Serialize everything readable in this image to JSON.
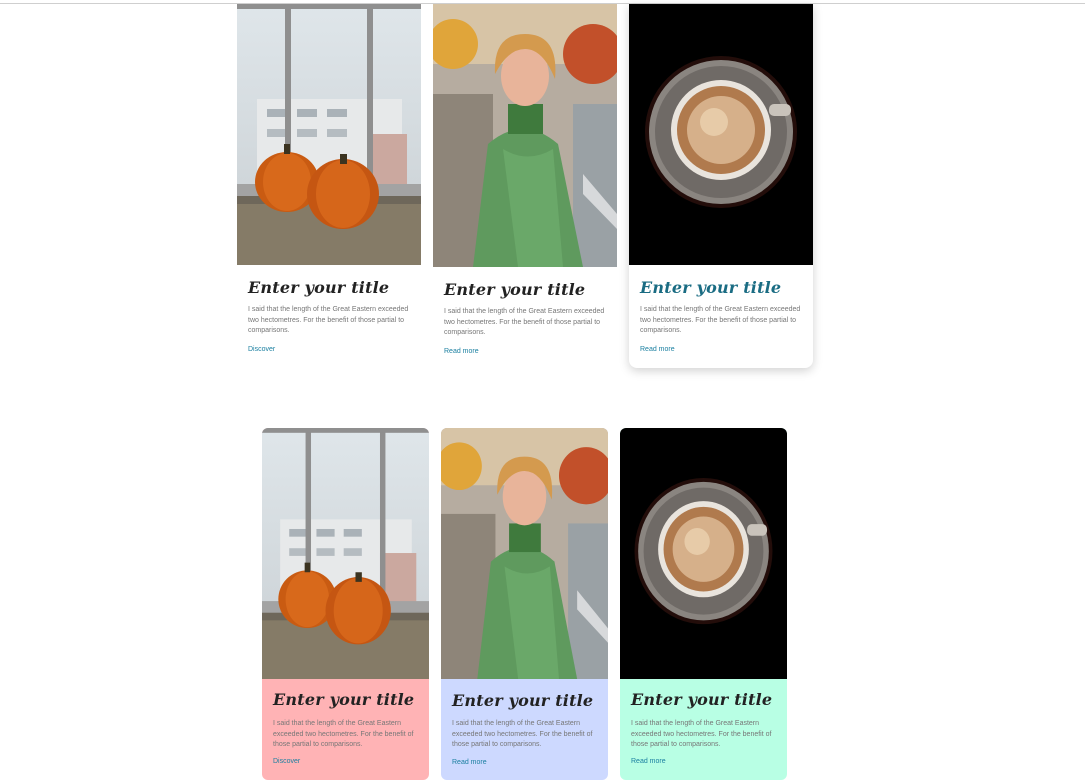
{
  "row1": {
    "cards": [
      {
        "image_icon": "pumpkins-photo",
        "title": "Enter your title",
        "text": "I said that the length of the Great Eastern exceeded two hectometres. For the benefit of those partial to comparisons.",
        "link": "Discover"
      },
      {
        "image_icon": "woman-portrait-photo",
        "title": "Enter your title",
        "text": "I said that the length of the Great Eastern exceeded two hectometres. For the benefit of those partial to comparisons.",
        "link": "Read more"
      },
      {
        "image_icon": "coffee-cup-photo",
        "title": "Enter your title",
        "text": "I said that the length of the Great Eastern exceeded two hectometres. For the benefit of those partial to comparisons.",
        "link": "Read more",
        "title_color": "#1a6c83"
      }
    ]
  },
  "row2": {
    "cards": [
      {
        "image_icon": "pumpkins-photo",
        "title": "Enter your title",
        "text": "I said that the length of the Great Eastern exceeded two hectometres. For the benefit of those partial to comparisons.",
        "link": "Discover",
        "background": "#ffb3b5"
      },
      {
        "image_icon": "woman-portrait-photo",
        "title": "Enter your title",
        "text": "I said that the length of the Great Eastern exceeded two hectometres. For the benefit of those partial to comparisons.",
        "link": "Read more",
        "background": "#cdd9ff"
      },
      {
        "image_icon": "coffee-cup-photo",
        "title": "Enter your title",
        "text": "I said that the length of the Great Eastern exceeded two hectometres. For the benefit of those partial to comparisons.",
        "link": "Read more",
        "background": "#b8ffe4"
      }
    ]
  },
  "colors": {
    "link": "#1a7fa0",
    "text": "#777777",
    "title": "#222222"
  }
}
